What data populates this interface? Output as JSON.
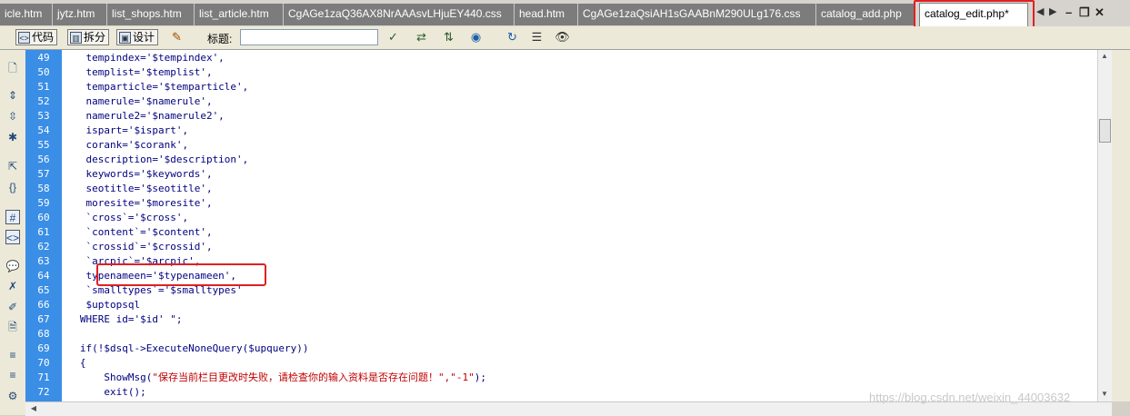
{
  "tabs": [
    {
      "label": "icle.htm",
      "active": false
    },
    {
      "label": "jytz.htm",
      "active": false
    },
    {
      "label": "list_shops.htm",
      "active": false
    },
    {
      "label": "list_article.htm",
      "active": false
    },
    {
      "label": "CgAGe1zaQ36AX8NrAAAsvLHjuEY440.css",
      "active": false
    },
    {
      "label": "head.htm",
      "active": false
    },
    {
      "label": "CgAGe1zaQsiAH1sGAABnM290ULg176.css",
      "active": false
    },
    {
      "label": "catalog_add.php",
      "active": false
    },
    {
      "label": "catalog_edit.php*",
      "active": true
    }
  ],
  "toolbar": {
    "code_label": "代码",
    "split_label": "拆分",
    "design_label": "设计",
    "title_label": "标题:",
    "title_value": ""
  },
  "code": {
    "lines": [
      {
        "n": "49",
        "text": "    tempindex='$tempindex',"
      },
      {
        "n": "50",
        "text": "    templist='$templist',"
      },
      {
        "n": "51",
        "text": "    temparticle='$temparticle',"
      },
      {
        "n": "52",
        "text": "    namerule='$namerule',"
      },
      {
        "n": "53",
        "text": "    namerule2='$namerule2',"
      },
      {
        "n": "54",
        "text": "    ispart='$ispart',"
      },
      {
        "n": "55",
        "text": "    corank='$corank',"
      },
      {
        "n": "56",
        "text": "    description='$description',"
      },
      {
        "n": "57",
        "text": "    keywords='$keywords',"
      },
      {
        "n": "58",
        "text": "    seotitle='$seotitle',"
      },
      {
        "n": "59",
        "text": "    moresite='$moresite',"
      },
      {
        "n": "60",
        "text": "    `cross`='$cross',"
      },
      {
        "n": "61",
        "text": "    `content`='$content',"
      },
      {
        "n": "62",
        "text": "    `crossid`='$crossid',"
      },
      {
        "n": "63",
        "text": "    `arcpic`='$arcpic',"
      },
      {
        "n": "64",
        "text": "    typenameen='$typenameen',"
      },
      {
        "n": "65",
        "text": "    `smalltypes`='$smalltypes'"
      },
      {
        "n": "66",
        "text": "    $uptopsql"
      },
      {
        "n": "67",
        "text": "   WHERE id='$id' \";"
      },
      {
        "n": "68",
        "text": ""
      },
      {
        "n": "69",
        "text": "   if(!$dsql->ExecuteNoneQuery($upquery))"
      },
      {
        "n": "70",
        "text": "   {"
      },
      {
        "n": "71",
        "text": "       ShowMsg(",
        "str": "\"保存当前栏目更改时失败，请检查你的输入资料是否存在问题！\",\"-1\"",
        "tail": ");"
      },
      {
        "n": "72",
        "text": "       exit();"
      }
    ]
  },
  "watermark": "https://blog.csdn.net/weixin_44003632",
  "colors": {
    "gutter": "#3a8ee6",
    "code_text": "#000080",
    "string_text": "#c00000",
    "highlight_box": "#e02020"
  }
}
